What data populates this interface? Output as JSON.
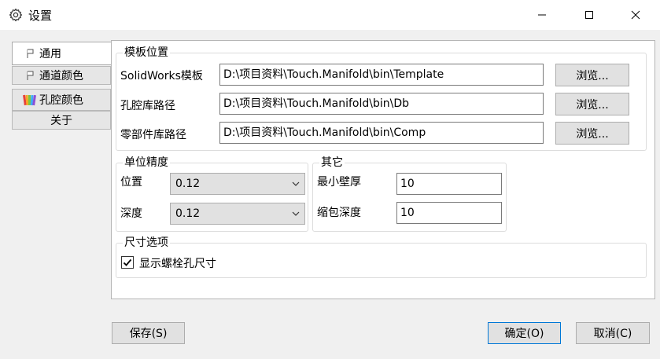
{
  "window": {
    "title": "设置",
    "icon": "gear-icon"
  },
  "tabs": [
    {
      "label": "通用",
      "icon": "flag-icon",
      "active": true
    },
    {
      "label": "通道颜色",
      "icon": "flag-icon",
      "active": false
    },
    {
      "label": "孔腔颜色",
      "icon": "palette-icon",
      "active": false
    },
    {
      "label": "关于",
      "icon": "",
      "active": false
    }
  ],
  "template_group": {
    "title": "模板位置",
    "rows": [
      {
        "label": "SolidWorks模板",
        "value": "D:\\项目资料\\Touch.Manifold\\bin\\Template",
        "button": "浏览..."
      },
      {
        "label": "孔腔库路径",
        "value": "D:\\项目资料\\Touch.Manifold\\bin\\Db",
        "button": "浏览..."
      },
      {
        "label": "零部件库路径",
        "value": "D:\\项目资料\\Touch.Manifold\\bin\\Comp",
        "button": "浏览..."
      }
    ]
  },
  "precision_group": {
    "title": "单位精度",
    "position_label": "位置",
    "position_value": "0.12",
    "depth_label": "深度",
    "depth_value": "0.12"
  },
  "other_group": {
    "title": "其它",
    "min_wall_label": "最小壁厚",
    "min_wall_value": "10",
    "shrink_depth_label": "缩包深度",
    "shrink_depth_value": "10"
  },
  "size_group": {
    "title": "尺寸选项",
    "show_bolt_hole_label": "显示螺栓孔尺寸",
    "show_bolt_hole_checked": true
  },
  "footer": {
    "save_label": "保存(S)",
    "ok_label": "确定(O)",
    "cancel_label": "取消(C)"
  }
}
